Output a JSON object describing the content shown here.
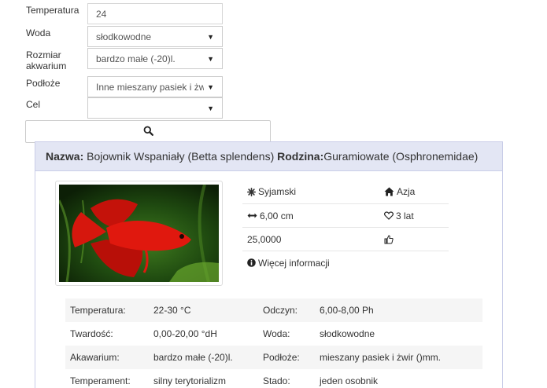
{
  "form": {
    "temperature_label": "Temperatura",
    "temperature_value": "24",
    "water_label": "Woda",
    "water_value": "słodkowodne",
    "size_label_line1": "Rozmiar",
    "size_label_line2": "akwarium",
    "size_value": "bardzo małe (-20)l.",
    "substrate_label": "Podłoże",
    "substrate_value": "Inne mieszany pasiek i żwir",
    "goal_label": "Cel",
    "goal_value": ""
  },
  "search": {
    "icon": "search-icon"
  },
  "card": {
    "name_label": "Nazwa:",
    "name_value": " Bojownik Wspaniały (Betta splendens) ",
    "family_label": "Rodzina:",
    "family_value": "Guramiowate (Osphronemidae)"
  },
  "info": {
    "breed": "Syjamski",
    "region": "Azja",
    "length": "6,00 cm",
    "lifespan": "3 lat",
    "price": "25,0000",
    "more_info": "Więcej informacji"
  },
  "details": [
    {
      "k1": "Temperatura:",
      "v1": "22-30 °C",
      "k2": "Odczyn:",
      "v2": "6,00-8,00 Ph"
    },
    {
      "k1": "Twardość:",
      "v1": "0,00-20,00 °dH",
      "k2": "Woda:",
      "v2": "słodkowodne"
    },
    {
      "k1": "Akawarium:",
      "v1": "bardzo małe (-20)l.",
      "k2": "Podłoże:",
      "v2": "mieszany pasiek i żwir ()mm."
    },
    {
      "k1": "Temperament:",
      "v1": "silny terytorializm",
      "k2": "Stado:",
      "v2": "jeden osobnik"
    }
  ],
  "colors": {
    "header_bg": "#e3e6f4",
    "card_border": "#c9cde8",
    "fish_red": "#e0180e"
  }
}
